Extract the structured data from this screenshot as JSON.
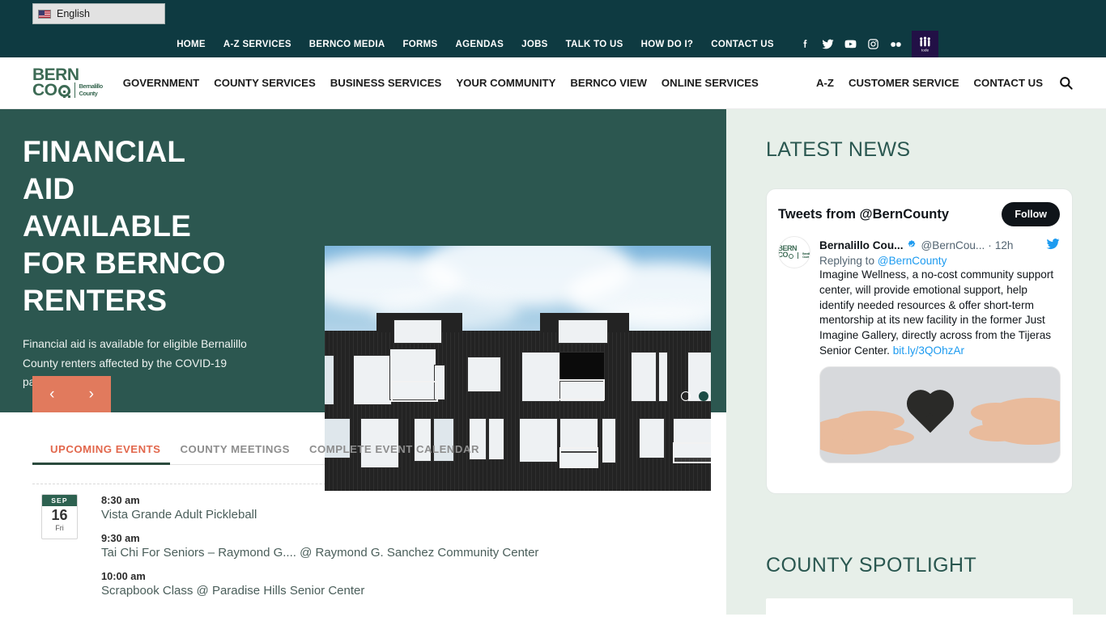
{
  "topbar": {
    "language": {
      "label": "English",
      "icon": "us-flag-icon"
    },
    "links": [
      "HOME",
      "A-Z SERVICES",
      "BERNCO MEDIA",
      "FORMS",
      "AGENDAS",
      "JOBS",
      "TALK TO US",
      "HOW DO I?",
      "CONTACT US"
    ],
    "social": [
      "facebook-icon",
      "twitter-icon",
      "youtube-icon",
      "instagram-icon",
      "flickr-icon",
      "nextdoor-icon"
    ],
    "bg_color": "#0e3a41"
  },
  "mainnav": {
    "logo": {
      "line1": "BERN",
      "line2": "CO",
      "sub1": "Bernalillo",
      "sub2": "County"
    },
    "links": [
      "GOVERNMENT",
      "COUNTY SERVICES",
      "BUSINESS SERVICES",
      "YOUR COMMUNITY",
      "BERNCO VIEW",
      "ONLINE SERVICES"
    ],
    "right_links": [
      "A-Z",
      "CUSTOMER SERVICE",
      "CONTACT US"
    ],
    "search_label": "Search"
  },
  "hero": {
    "title_lines": [
      "FINANCIAL",
      "AID",
      "AVAILABLE",
      "FOR BERNCO",
      "RENTERS"
    ],
    "description": "Financial aid is available for eligible Bernalillo County renters affected by the COVID-19 pandemic.",
    "prev_label": "‹",
    "next_label": "›",
    "slide_count": 2,
    "active_slide": 2,
    "bg_color": "#2c5750",
    "control_color": "#e17a5d",
    "image_alt": "dark modern apartment building under cloudy blue sky"
  },
  "events": {
    "tabs": [
      {
        "label": "UPCOMING EVENTS",
        "active": true
      },
      {
        "label": "COUNTY MEETINGS",
        "active": false
      },
      {
        "label": "COMPLETE EVENT CALENDAR",
        "active": false
      }
    ],
    "active_color": "#e2674c",
    "date": {
      "month": "SEP",
      "day": "16",
      "weekday": "Fri"
    },
    "items": [
      {
        "time": "8:30 am",
        "title": "Vista Grande Adult Pickleball"
      },
      {
        "time": "9:30 am",
        "title": "Tai Chi For Seniors – Raymond G.... @ Raymond G. Sanchez Community Center"
      },
      {
        "time": "10:00 am",
        "title": "Scrapbook Class @ Paradise Hills Senior Center"
      }
    ]
  },
  "latest_news": {
    "heading": "LATEST NEWS",
    "widget": {
      "title": "Tweets from @BernCounty",
      "follow_label": "Follow",
      "tweet": {
        "display_name": "Bernalillo Cou...",
        "handle": "@BernCou...",
        "separator": "·",
        "time": "12h",
        "replying_prefix": "Replying to ",
        "replying_to": "@BernCounty",
        "body": "Imagine Wellness, a no-cost community support center, will provide emotional support, help identify needed resources & offer short-term mentorship at its new facility in the former Just Imagine Gallery, directly across from the Tijeras Senior Center. ",
        "link": "bit.ly/3QOhzAr",
        "media_alt": "two hands passing a black paper heart"
      }
    }
  },
  "spotlight": {
    "heading": "COUNTY SPOTLIGHT"
  },
  "colors": {
    "topbar": "#0e3a41",
    "hero": "#2c5750",
    "accent_orange": "#e17a5d",
    "sidebar_bg": "#e7efe9",
    "heading_green": "#2a5750"
  }
}
